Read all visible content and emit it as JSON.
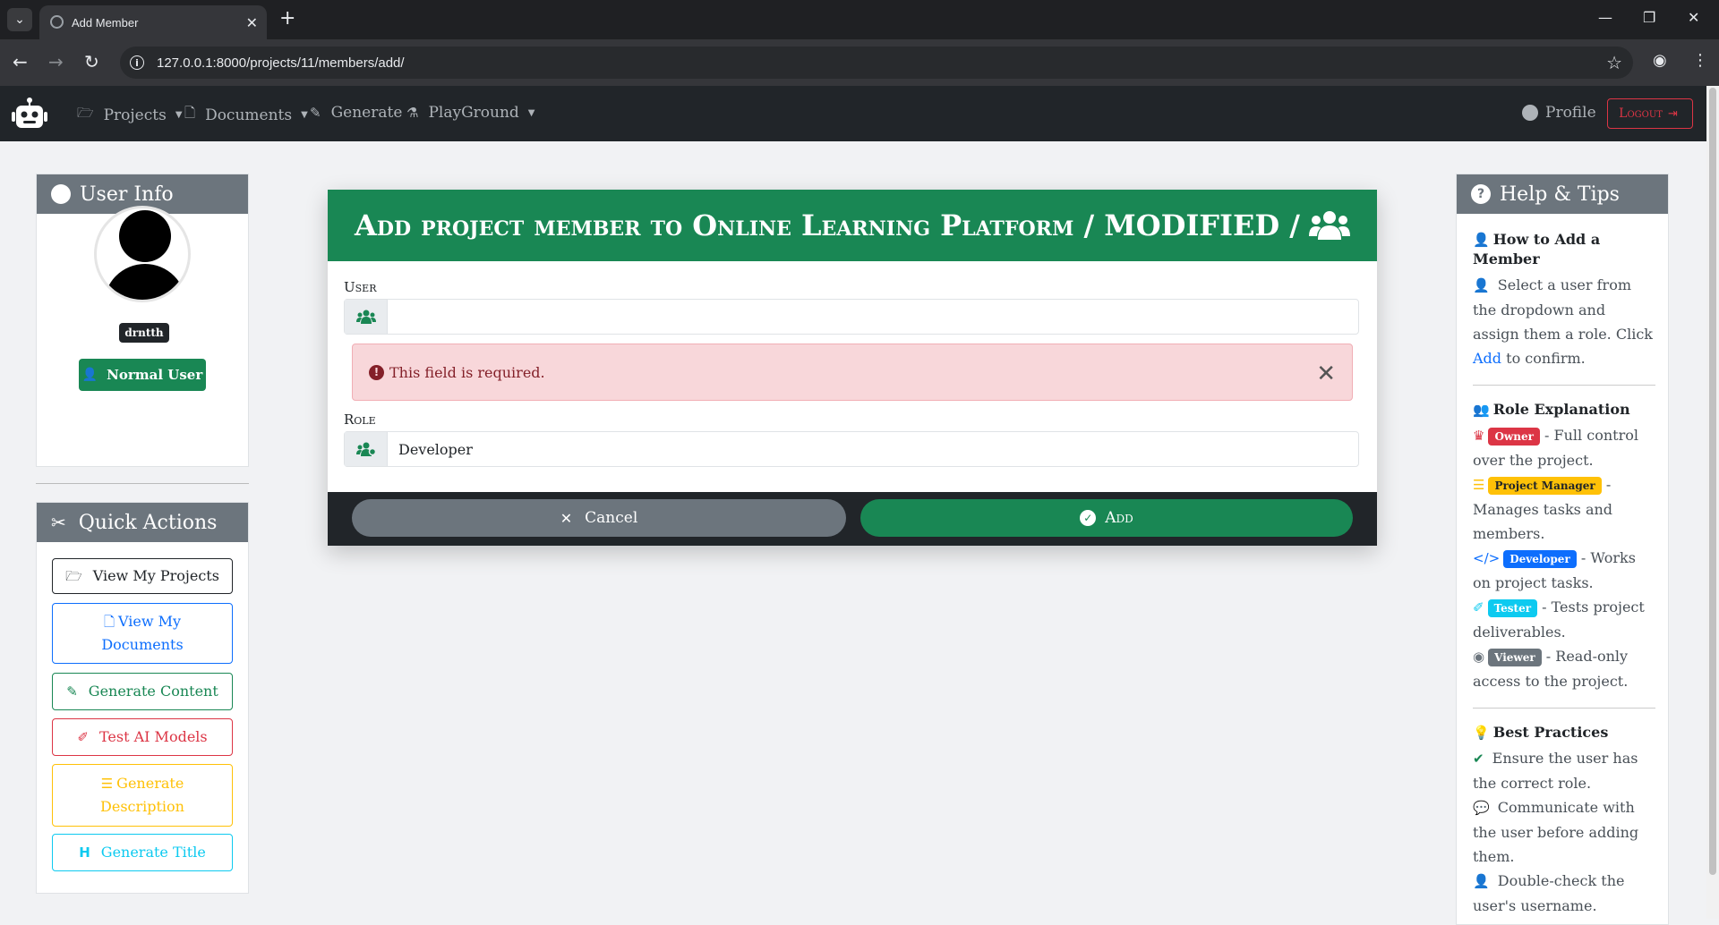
{
  "browser": {
    "tab_title": "Add Member",
    "url": "127.0.0.1:8000/projects/11/members/add/"
  },
  "navbar": {
    "items": [
      {
        "label": "Projects",
        "icon": "folder-open-icon",
        "dropdown": true
      },
      {
        "label": "Documents",
        "icon": "file-icon",
        "dropdown": true
      },
      {
        "label": "Generate",
        "icon": "pencil-icon",
        "dropdown": false
      },
      {
        "label": "PlayGround",
        "icon": "flask-icon",
        "dropdown": true
      }
    ],
    "profile_label": "Profile",
    "logout_label": "Logout"
  },
  "user_info": {
    "title": "User Info",
    "username": "drntth",
    "role_badge": "Normal User"
  },
  "quick_actions": {
    "title": "Quick Actions",
    "buttons": [
      {
        "label": "View My Projects",
        "color": "#212529",
        "icon": "folder-open-icon"
      },
      {
        "label": "View My Documents",
        "color": "#0d6efd",
        "icon": "file-icon"
      },
      {
        "label": "Generate Content",
        "color": "#198754",
        "icon": "pencil-icon"
      },
      {
        "label": "Test AI Models",
        "color": "#dc3545",
        "icon": "eyedropper-icon"
      },
      {
        "label": "Generate Description",
        "color": "#ffc107",
        "icon": "align-left-icon"
      },
      {
        "label": "Generate Title",
        "color": "#0dcaf0",
        "icon": "heading-icon"
      }
    ]
  },
  "form": {
    "title": "Add project member to Online Learning Platform / MODIFIED /",
    "user_label": "User",
    "user_value": "",
    "error_message": "This field is required.",
    "role_label": "Role",
    "role_value": "Developer",
    "cancel_label": "Cancel",
    "add_label": "Add"
  },
  "help": {
    "title": "Help & Tips",
    "how_to_title": "How to Add a Member",
    "how_to_text_1": "Select a user from the dropdown and assign them a role. Click",
    "how_to_link": "Add",
    "how_to_text_2": "to confirm.",
    "roles_title": "Role Explanation",
    "roles": [
      {
        "badge": "Owner",
        "color": "#dc3545",
        "desc": "- Full control over the project."
      },
      {
        "badge": "Project Manager",
        "color": "#ffc107",
        "desc": "- Manages tasks and members."
      },
      {
        "badge": "Developer",
        "color": "#0d6efd",
        "desc": "- Works on project tasks."
      },
      {
        "badge": "Tester",
        "color": "#0dcaf0",
        "desc": "- Tests project deliverables."
      },
      {
        "badge": "Viewer",
        "color": "#6c757d",
        "desc": "- Read-only access to the project."
      }
    ],
    "best_title": "Best Practices",
    "best": [
      "Ensure the user has the correct role.",
      "Communicate with the user before adding them.",
      "Double-check the user's username."
    ]
  }
}
